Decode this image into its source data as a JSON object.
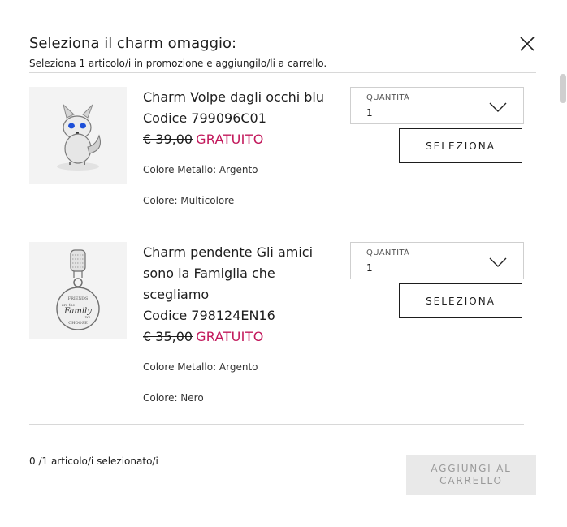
{
  "modal": {
    "title": "Seleziona il charm omaggio:",
    "subtitle": "Seleziona 1 articolo/i in promozione e aggiungilo/li a carrello."
  },
  "products": [
    {
      "name": "Charm Volpe dagli occhi blu",
      "code": "Codice 799096C01",
      "old_price": "€ 39,00",
      "free_label": "GRATUITO",
      "metal_color": "Colore Metallo: Argento",
      "color": "Colore: Multicolore",
      "image_icon": "fox-charm-image",
      "quantity_label": "QUANTITÁ",
      "quantity_value": "1",
      "select_label": "SELEZIONA"
    },
    {
      "name": "Charm pendente Gli amici sono la Famiglia che scegliamo",
      "code": "Codice 798124EN16",
      "old_price": "€ 35,00",
      "free_label": "GRATUITO",
      "metal_color": "Colore Metallo: Argento",
      "color": "Colore: Nero",
      "image_icon": "family-dangle-charm-image",
      "engraving": [
        "FRIENDS",
        "are the",
        "Family",
        "we",
        "CHOOSE"
      ],
      "quantity_label": "QUANTITÁ",
      "quantity_value": "1",
      "select_label": "SELEZIONA"
    }
  ],
  "footer": {
    "counter": "0 /1 articolo/i selezionato/i",
    "add_button": "AGGIUNGI AL CARRELLO"
  },
  "colors": {
    "accent_free": "#c2185b",
    "disabled_bg": "#e9e9e9",
    "disabled_text": "#9a9a9a"
  }
}
